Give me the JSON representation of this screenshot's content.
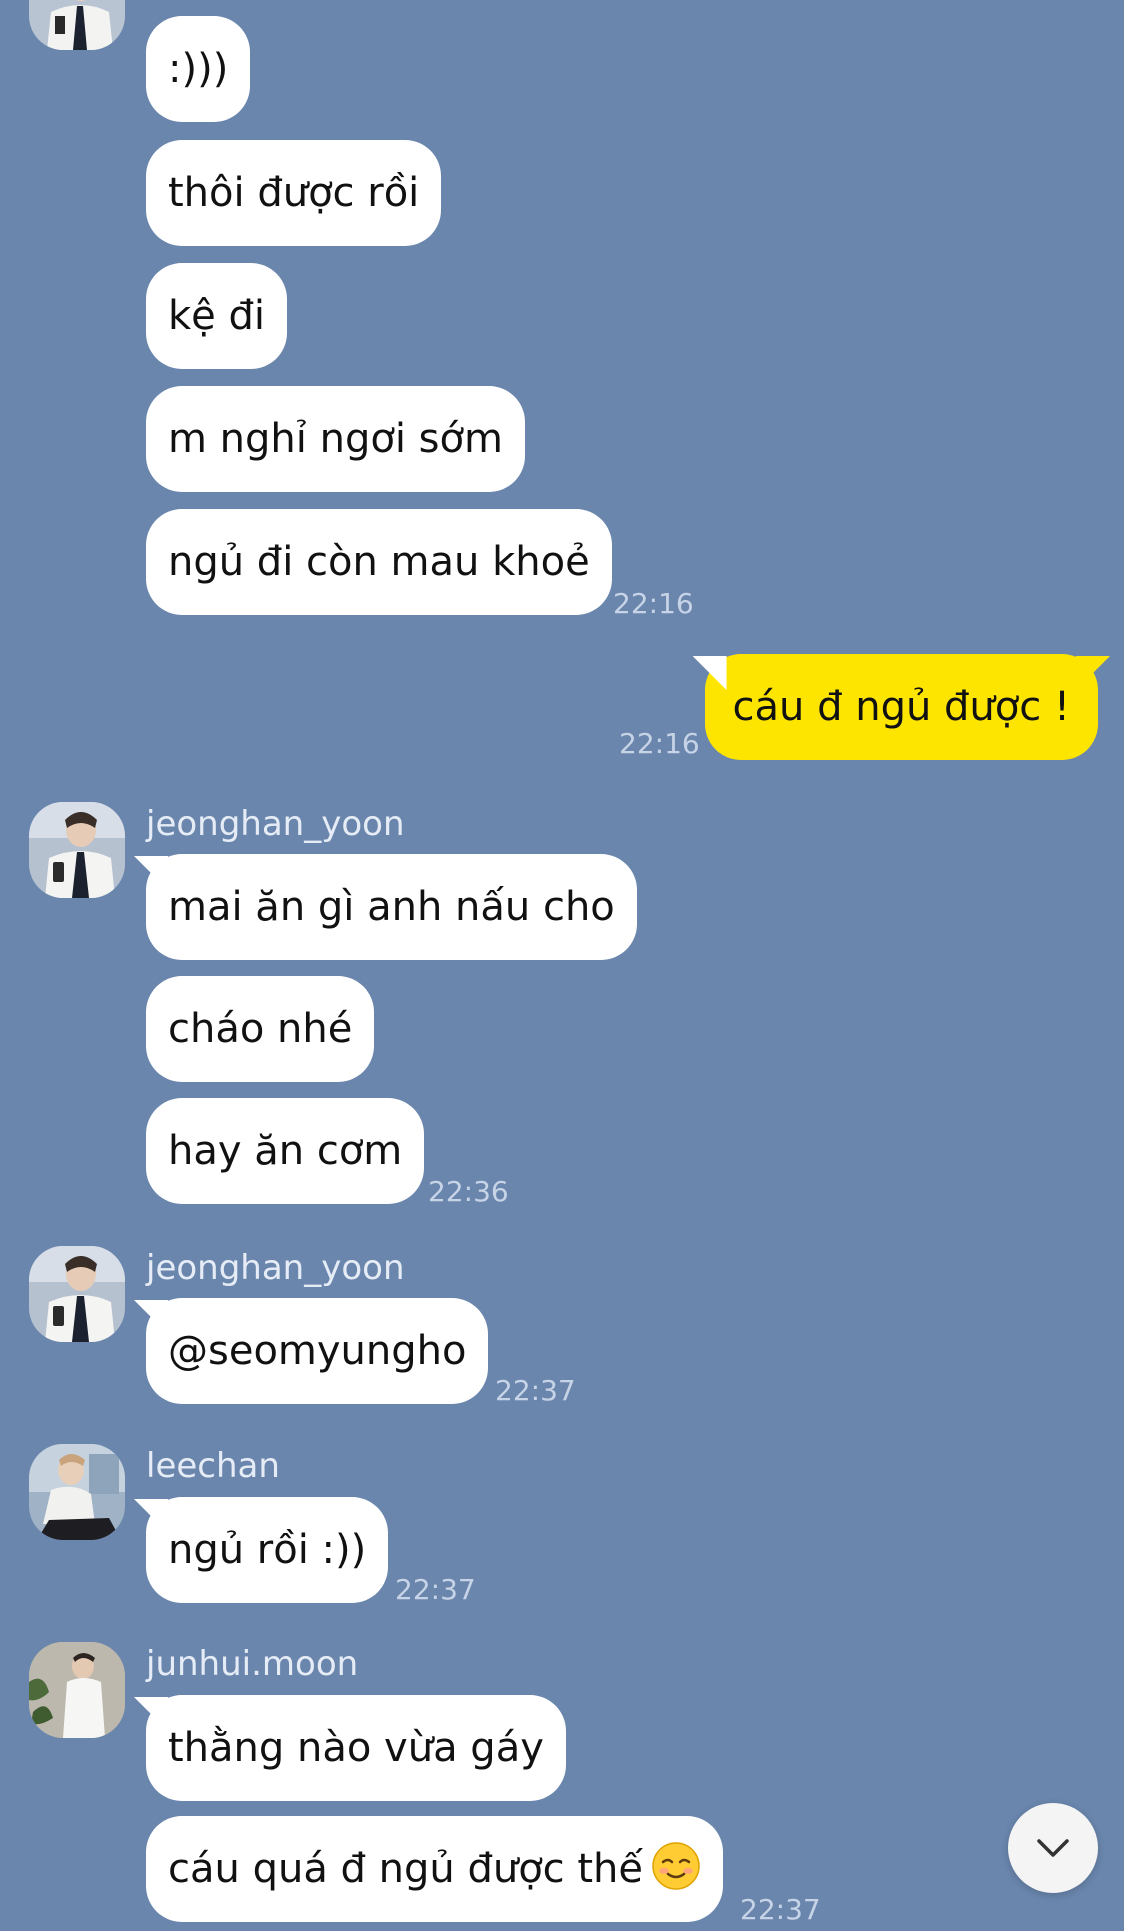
{
  "messages": {
    "m1": "thôi được rồi",
    "m0": ":)))",
    "m2": "kệ đi",
    "m3": "m nghỉ ngơi sớm",
    "m4": "ngủ đi còn mau khoẻ",
    "t4": "22:16",
    "me1": "cáu đ ngủ được !",
    "tme1": "22:16",
    "s1": "jeonghan_yoon",
    "m5": "mai ăn gì anh nấu cho",
    "m6": "cháo nhé",
    "m7": "hay ăn cơm",
    "t7": "22:36",
    "s2": "jeonghan_yoon",
    "m8": "@seomyungho",
    "t8": "22:37",
    "s3": "leechan",
    "m9": "ngủ rồi :))",
    "t9": "22:37",
    "s4": "junhui.moon",
    "m10": "thằng nào vừa gáy",
    "m11": "cáu quá đ ngủ được thế",
    "t11": "22:37"
  },
  "icons": {
    "emoji": "smiling-face-icon",
    "scroll": "chevron-down-icon"
  },
  "colors": {
    "background": "#6a86ad",
    "incoming_bubble": "#ffffff",
    "outgoing_bubble": "#fee500"
  }
}
